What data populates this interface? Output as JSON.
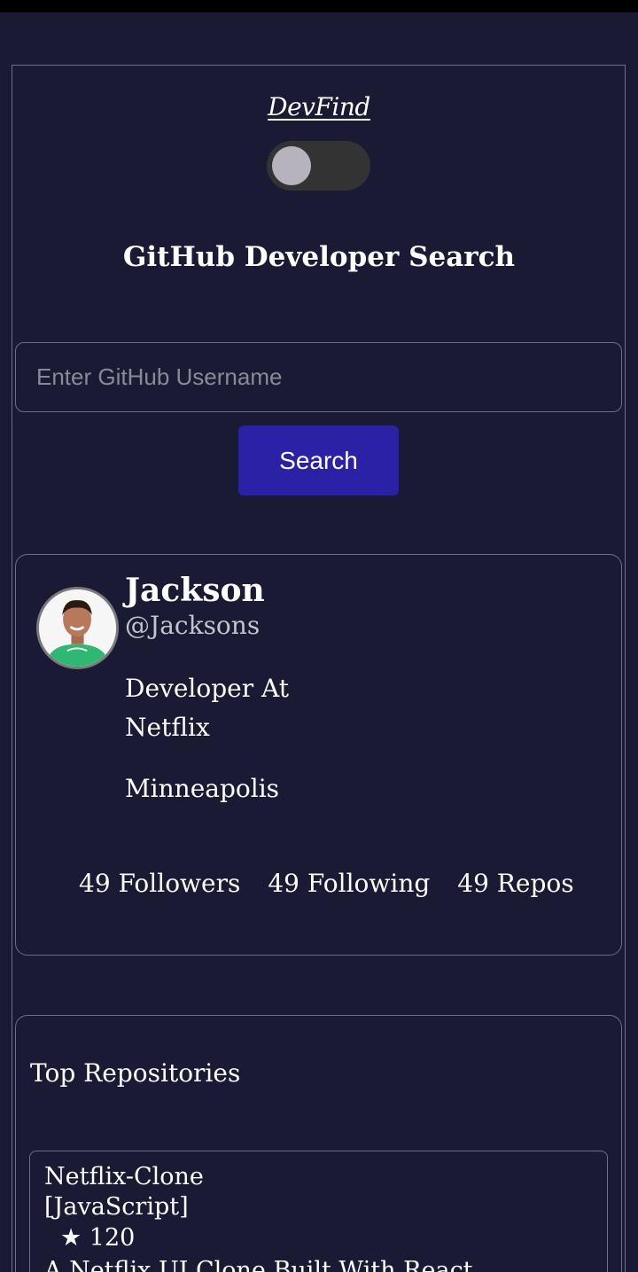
{
  "app": {
    "logo": "DevFind",
    "title": "GitHub Developer Search"
  },
  "theme_toggle": {
    "state": "off"
  },
  "search": {
    "placeholder": "Enter GitHub Username",
    "value": "",
    "button_label": "Search"
  },
  "profile": {
    "name": "Jackson",
    "login": "@Jacksons",
    "bio_line1": "Developer At",
    "bio_line2": "Netflix",
    "location": "Minneapolis",
    "followers": "49 Followers",
    "following": "49 Following",
    "repos": "49 Repos"
  },
  "repositories": {
    "title": "Top Repositories",
    "items": [
      {
        "name": "Netflix-Clone",
        "language": "[JavaScript]",
        "stars": "★ 120",
        "description": "A Netflix UI Clone Built With React"
      }
    ]
  },
  "colors": {
    "background": "#1a1a35",
    "border": "#6e6e82",
    "button": "#2a21a6",
    "toggle_track": "#333333",
    "toggle_knob": "#b6b3bd"
  }
}
